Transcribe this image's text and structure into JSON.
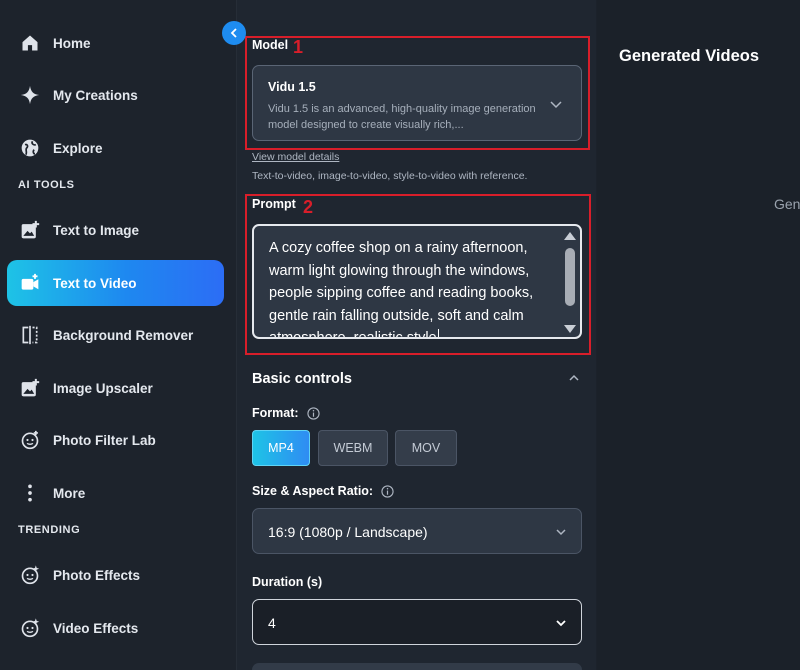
{
  "sidebar": {
    "items": [
      {
        "label": "Home",
        "icon": "home-icon"
      },
      {
        "label": "My Creations",
        "icon": "sparkle-icon"
      },
      {
        "label": "Explore",
        "icon": "globe-icon"
      },
      {
        "label": "Text to Image",
        "icon": "image-plus-icon"
      },
      {
        "label": "Text to Video",
        "icon": "video-plus-icon",
        "active": true
      },
      {
        "label": "Background Remover",
        "icon": "split-frame-icon"
      },
      {
        "label": "Image Upscaler",
        "icon": "image-plus-icon"
      },
      {
        "label": "Photo Filter Lab",
        "icon": "face-icon"
      },
      {
        "label": "More",
        "icon": "more-vertical-icon"
      },
      {
        "label": "Photo Effects",
        "icon": "face-sparkle-icon"
      },
      {
        "label": "Video Effects",
        "icon": "face-sparkle-icon"
      }
    ],
    "sections": {
      "ai_tools": "AI TOOLS",
      "trending": "TRENDING"
    }
  },
  "form": {
    "model": {
      "title": "Model",
      "annotation": "1",
      "name": "Vidu 1.5",
      "description": "Vidu 1.5 is an advanced, high-quality image generation model designed to create visually rich,...",
      "details_link": "View model details",
      "help": "Text-to-video, image-to-video, style-to-video with reference."
    },
    "prompt": {
      "title": "Prompt",
      "annotation": "2",
      "value": "A cozy coffee shop on a rainy afternoon, warm light glowing through the windows, people sipping coffee and reading books, gentle rain falling outside, soft and calm atmosphere, realistic style"
    },
    "basic_controls": {
      "title": "Basic controls",
      "format_label": "Format:",
      "formats": [
        "MP4",
        "WEBM",
        "MOV"
      ],
      "selected_format": "MP4",
      "size_label": "Size & Aspect Ratio:",
      "size_value": "16:9 (1080p / Landscape)",
      "duration_label": "Duration (s)",
      "duration_value": "4"
    }
  },
  "right": {
    "title": "Generated Videos",
    "clipped_text": "Gen"
  },
  "colors": {
    "accent": "#1e8cf0",
    "annotation_red": "#d81e2a",
    "panel_bg": "#1f2630"
  }
}
